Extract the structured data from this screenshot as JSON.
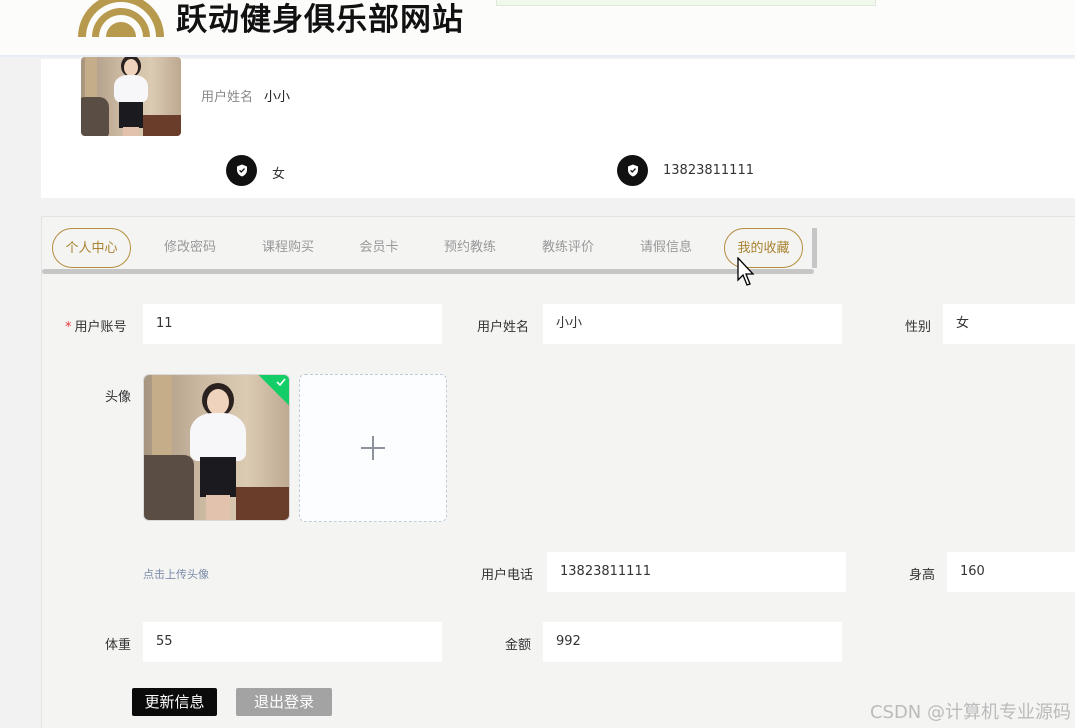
{
  "header": {
    "site_title": "跃动健身俱乐部网站",
    "brand_color": "#b89a4e"
  },
  "profile_summary": {
    "name_label": "用户姓名",
    "name_value": "小小",
    "gender": "女",
    "phone": "13823811111"
  },
  "tabs": [
    {
      "label": "个人中心",
      "active": true
    },
    {
      "label": "修改密码",
      "active": false
    },
    {
      "label": "课程购买",
      "active": false
    },
    {
      "label": "会员卡",
      "active": false
    },
    {
      "label": "预约教练",
      "active": false
    },
    {
      "label": "教练评价",
      "active": false
    },
    {
      "label": "请假信息",
      "active": false
    },
    {
      "label": "我的收藏",
      "active": false,
      "hover": true
    }
  ],
  "form": {
    "account_label": "用户账号",
    "account_value": "11",
    "name_label": "用户姓名",
    "name_value": "小小",
    "gender_label": "性别",
    "gender_value": "女",
    "avatar_label": "头像",
    "upload_tip": "点击上传头像",
    "phone_label": "用户电话",
    "phone_value": "13823811111",
    "height_label": "身高",
    "height_value": "160",
    "weight_label": "体重",
    "weight_value": "55",
    "amount_label": "金额",
    "amount_value": "992"
  },
  "buttons": {
    "update": "更新信息",
    "logout": "退出登录"
  },
  "watermark": "CSDN @计算机专业源码",
  "icons": {
    "info_icon": "shield-check-icon",
    "upload_icon": "plus-icon",
    "success_icon": "check-icon"
  }
}
